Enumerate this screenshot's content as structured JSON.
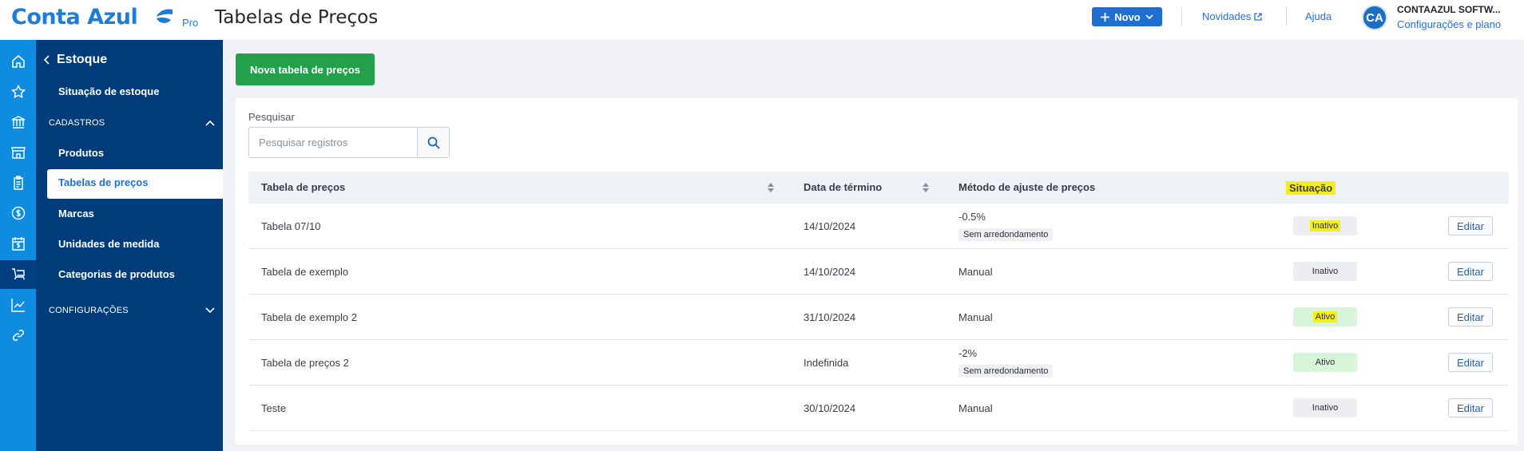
{
  "brand": {
    "name": "Conta Azul",
    "tier": "Pro",
    "accent": "#1c7ed6"
  },
  "header": {
    "title": "Tabelas de Preços",
    "new_button": "Novo",
    "news_link": "Novidades",
    "help_link": "Ajuda",
    "avatar_initials": "CA",
    "company_name": "CONTAAZUL SOFTW...",
    "plan_link": "Configurações e plano"
  },
  "rail": {
    "icons": [
      "home-icon",
      "star-icon",
      "bank-icon",
      "store-icon",
      "clipboard-icon",
      "dollar-icon",
      "calendar-dollar-icon",
      "cart-icon",
      "chart-icon",
      "link-icon"
    ],
    "active": "cart-icon"
  },
  "submenu": {
    "title": "Estoque",
    "top_item": "Situação de estoque",
    "section_cadastros": "CADASTROS",
    "items": [
      "Produtos",
      "Tabelas de preços",
      "Marcas",
      "Unidades de medida",
      "Categorias de produtos"
    ],
    "active_item": "Tabelas de preços",
    "section_config": "CONFIGURAÇÕES"
  },
  "main": {
    "new_table_button": "Nova tabela de preços",
    "search_label": "Pesquisar",
    "search_placeholder": "Pesquisar registros",
    "columns": [
      "Tabela de preços",
      "Data de término",
      "Método de ajuste de preços",
      "Situação"
    ],
    "edit_label": "Editar",
    "rows": [
      {
        "name": "Tabela 07/10",
        "end_date": "14/10/2024",
        "method": "-0.5%",
        "rounding": "Sem arredondamento",
        "status": "Inativo",
        "active": false
      },
      {
        "name": "Tabela de exemplo",
        "end_date": "14/10/2024",
        "method": "Manual",
        "rounding": "",
        "status": "Inativo",
        "active": false
      },
      {
        "name": "Tabela de exemplo 2",
        "end_date": "31/10/2024",
        "method": "Manual",
        "rounding": "",
        "status": "Ativo",
        "active": true
      },
      {
        "name": "Tabela de preços 2",
        "end_date": "Indefinida",
        "method": "-2%",
        "rounding": "Sem arredondamento",
        "status": "Ativo",
        "active": true
      },
      {
        "name": "Teste",
        "end_date": "30/10/2024",
        "method": "Manual",
        "rounding": "",
        "status": "Inativo",
        "active": false
      }
    ]
  },
  "colors": {
    "primary_button": "#1f6fd1",
    "create_button": "#23a04a",
    "sidebar": "#003c7a",
    "rail": "#0d8ce0",
    "highlight": "#f5ee1e"
  }
}
